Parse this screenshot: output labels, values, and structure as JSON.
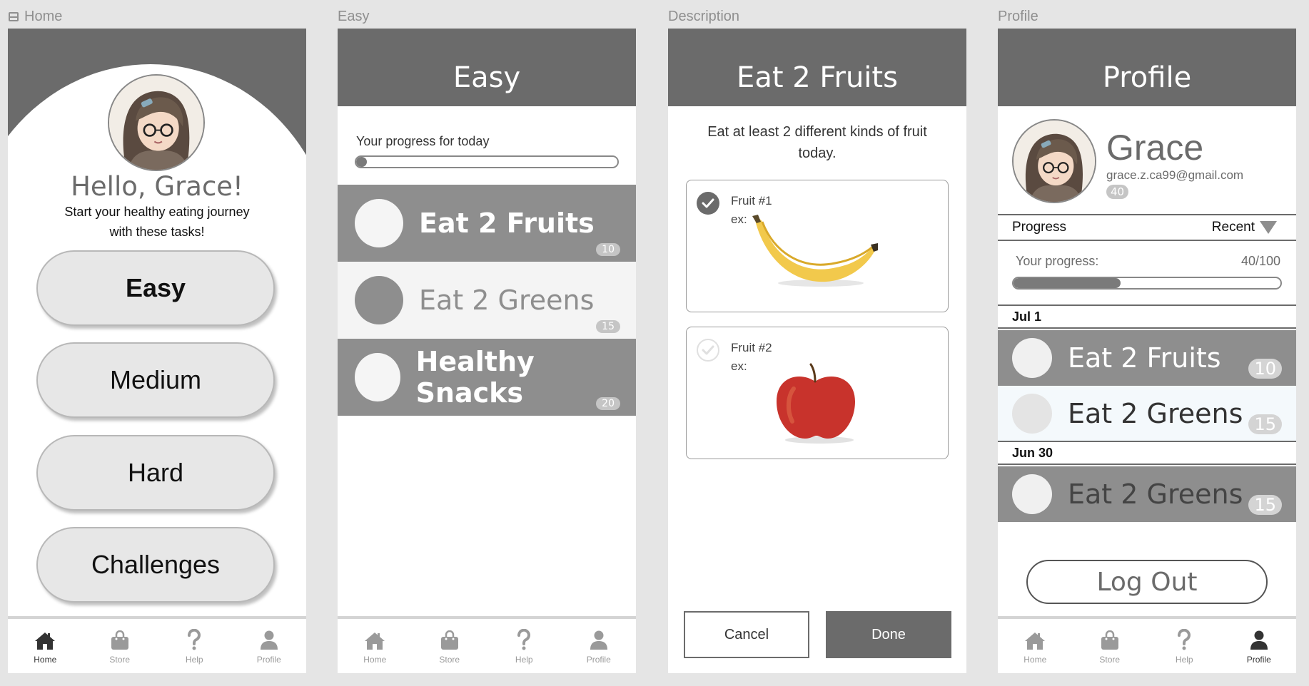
{
  "frames": {
    "home": "Home",
    "easy": "Easy",
    "description": "Description",
    "profile": "Profile"
  },
  "tabs": [
    {
      "label": "Home",
      "icon": "home-icon"
    },
    {
      "label": "Store",
      "icon": "shopping-bag-icon"
    },
    {
      "label": "Help",
      "icon": "question-icon"
    },
    {
      "label": "Profile",
      "icon": "person-icon"
    }
  ],
  "home": {
    "greeting": "Hello, Grace!",
    "subtitle_line1": "Start your healthy eating journey",
    "subtitle_line2": "with these tasks!",
    "buttons": [
      "Easy",
      "Medium",
      "Hard",
      "Challenges"
    ]
  },
  "easy": {
    "title": "Easy",
    "progress_label": "Your progress for today",
    "progress": 0.02,
    "tasks": [
      {
        "name": "Eat 2 Fruits",
        "points": "10"
      },
      {
        "name": "Eat 2 Greens",
        "points": "15"
      },
      {
        "name": "Healthy Snacks",
        "points": "20"
      }
    ]
  },
  "description": {
    "title": "Eat 2 Fruits",
    "text_line1": "Eat at least 2 different kinds of fruit",
    "text_line2": "today.",
    "cards": [
      {
        "label": "Fruit #1",
        "example": "ex:",
        "checked": true,
        "image": "banana"
      },
      {
        "label": "Fruit #2",
        "example": "ex:",
        "checked": false,
        "image": "apple"
      }
    ],
    "cancel": "Cancel",
    "done": "Done"
  },
  "profile": {
    "title": "Profile",
    "name": "Grace",
    "email": "grace.z.ca99@gmail.com",
    "points": "40",
    "progress_heading": "Progress",
    "sort": "Recent",
    "progress_label": "Your progress:",
    "progress_value": "40/100",
    "progress": 0.4,
    "groups": [
      {
        "date": "Jul 1",
        "items": [
          {
            "name": "Eat 2 Fruits",
            "points": "10"
          },
          {
            "name": "Eat 2 Greens",
            "points": "15"
          }
        ]
      },
      {
        "date": "Jun 30",
        "items": [
          {
            "name": "Eat 2 Greens",
            "points": "15"
          }
        ]
      }
    ],
    "logout": "Log Out"
  },
  "colors": {
    "header": "#6b6b6b",
    "row_dark": "#8e8e8e",
    "row_light": "#f4f4f4",
    "row_blue": "#f4f9fc",
    "active": "#333333",
    "inactive": "#9a9a9a"
  }
}
